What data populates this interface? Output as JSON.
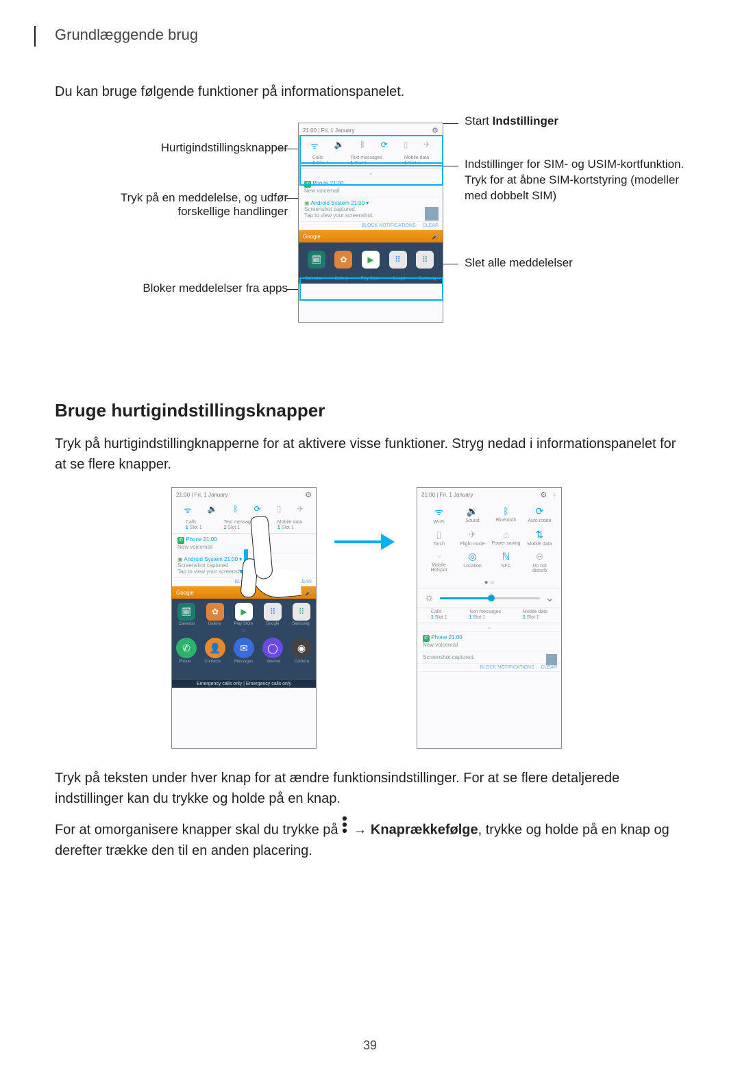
{
  "header": "Grundlæggende brug",
  "intro": "Du kan bruge følgende funktioner på informationspanelet.",
  "callouts": {
    "left": {
      "quick": "Hurtigindstillingsknapper",
      "notif": "Tryk på en meddelelse, og udfør forskellige handlinger",
      "block": "Bloker meddelelser fra apps"
    },
    "right": {
      "settings_pre": "Start ",
      "settings_bold": "Indstillinger",
      "sim": "Indstillinger for SIM- og USIM-kortfunktion. Tryk for at åbne SIM-kortstyring (modeller med dobbelt SIM)",
      "clear": "Slet alle meddelelser"
    }
  },
  "section_heading": "Bruge hurtigindstillingsknapper",
  "section_p1": "Tryk på hurtigindstillingknapperne for at aktivere visse funktioner. Stryg nedad i informationspanelet for at se flere knapper.",
  "section_p2": "Tryk på teksten under hver knap for at ændre funktionsindstillinger. For at se flere detaljerede indstillinger kan du trykke og holde på en knap.",
  "section_p3_pre": "For at omorganisere knapper skal du trykke på ",
  "section_p3_arrow": " → ",
  "section_p3_bold": "Knaprækkefølge",
  "section_p3_post": ", trykke og holde på en knap og derefter trække den til en anden placering.",
  "phone": {
    "status_time": "21:00  |  Fri, 1 January",
    "sim": {
      "col1": {
        "title": "Calls",
        "badge": "1",
        "sub": "Slot 1"
      },
      "col2": {
        "title": "Text messages",
        "badge": "1",
        "sub": "Slot 1"
      },
      "col3": {
        "title": "Mobile data",
        "badge": "1",
        "sub": "Slot 1"
      }
    },
    "notif1": {
      "row1": "Phone  21:00",
      "row2": "New voicemail"
    },
    "notif2": {
      "row1": "Android System  21:00  ▾",
      "row2": "Screenshot captured.",
      "row3": "Tap to view your screenshot."
    },
    "block_labels": {
      "block": "BLOCK NOTIFICATIONS",
      "clear": "CLEAR"
    },
    "search": "Google",
    "dock": [
      "Calendar",
      "Gallery",
      "Play Store",
      "Google",
      "Samsung"
    ],
    "home_labels": [
      "Phone",
      "Contacts",
      "Messages",
      "Internet",
      "Camera"
    ],
    "emergency": "Emergency calls only | Emergency calls only"
  },
  "qt": {
    "row1": [
      "Wi-Fi",
      "Sound",
      "Bluetooth",
      "Auto rotate"
    ],
    "row2": [
      "Torch",
      "Flight mode",
      "Power saving",
      "Mobile data"
    ],
    "row3": [
      "Mobile Hotspot",
      "Location",
      "NFC",
      "Do not disturb"
    ]
  },
  "page_num": "39"
}
